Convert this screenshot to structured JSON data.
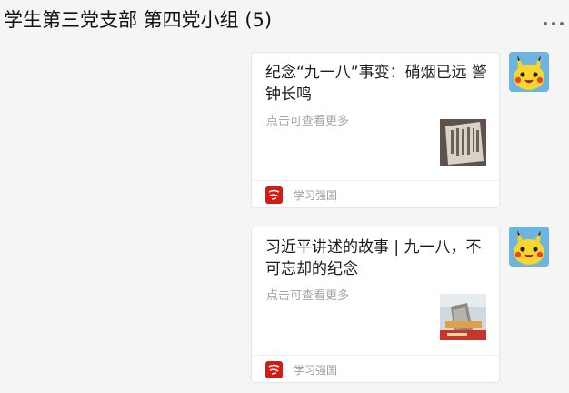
{
  "header": {
    "title": "学生第三党支部 第四党小组 (5)",
    "more_icon": "more-dots-icon"
  },
  "messages": [
    {
      "title": "纪念“九一八”事变：硝烟已远 警钟长鸣",
      "desc": "点击可查看更多",
      "source": "学习强国",
      "thumb_icon": "newspaper-thumbnail",
      "avatar_icon": "pikachu-avatar"
    },
    {
      "title": "习近平讲述的故事 | 九一八，不可忘却的纪念",
      "desc": "点击可查看更多",
      "source": "学习强国",
      "thumb_icon": "memorial-thumbnail",
      "avatar_icon": "pikachu-avatar"
    }
  ],
  "colors": {
    "background": "#f5f5f5",
    "card": "#ffffff",
    "source_logo": "#d31b13"
  }
}
